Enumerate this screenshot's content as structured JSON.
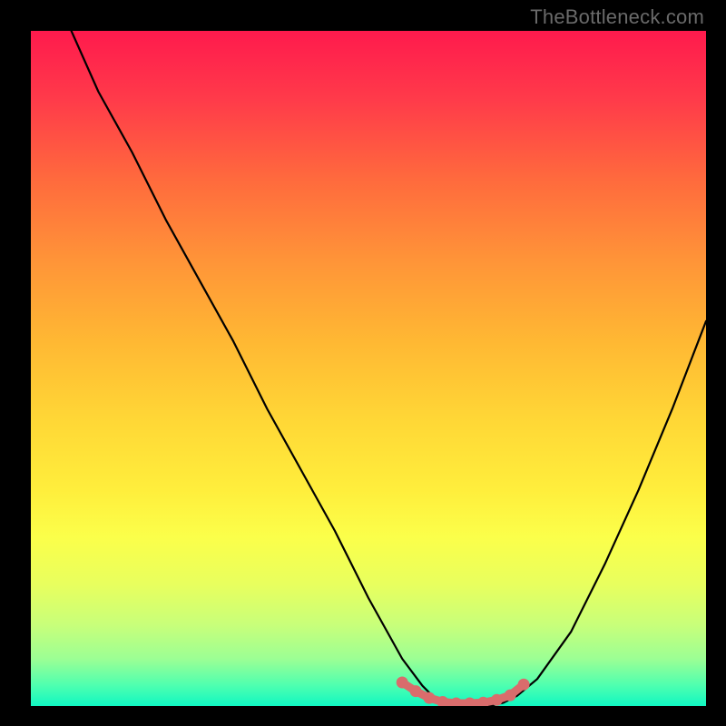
{
  "watermark": "TheBottleneck.com",
  "chart_data": {
    "type": "line",
    "title": "",
    "xlabel": "",
    "ylabel": "",
    "xlim": [
      0,
      100
    ],
    "ylim": [
      0,
      100
    ],
    "series": [
      {
        "name": "bottleneck-curve",
        "x": [
          6,
          10,
          15,
          20,
          25,
          30,
          35,
          40,
          45,
          50,
          55,
          58,
          60,
          62,
          65,
          68,
          70,
          72,
          75,
          80,
          85,
          90,
          95,
          100
        ],
        "y": [
          100,
          91,
          82,
          72,
          63,
          54,
          44,
          35,
          26,
          16,
          7,
          3,
          1,
          0,
          0,
          0,
          0.5,
          1.5,
          4,
          11,
          21,
          32,
          44,
          57
        ],
        "color": "#000000"
      }
    ],
    "markers": {
      "name": "optimal-range",
      "color": "#d96c6c",
      "x": [
        55,
        57,
        59,
        61,
        63,
        65,
        67,
        69,
        71,
        73
      ],
      "y": [
        3.5,
        2.2,
        1.2,
        0.6,
        0.4,
        0.4,
        0.5,
        0.9,
        1.6,
        3.2
      ]
    }
  }
}
